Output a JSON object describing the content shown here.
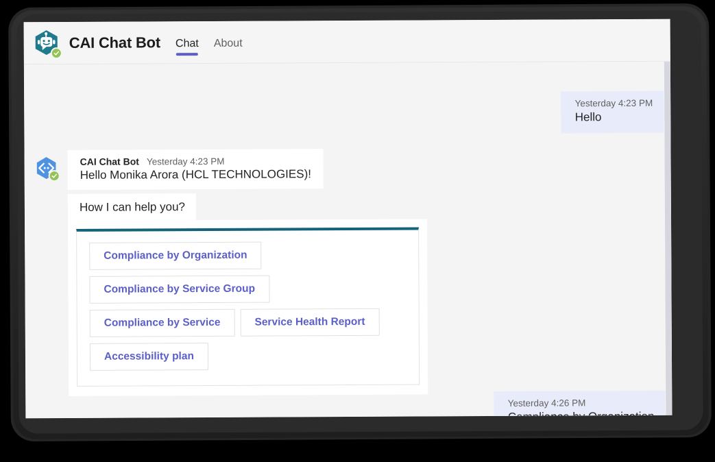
{
  "app": {
    "title": "CAI Chat Bot",
    "avatar_icon": "robot-hexagon-icon",
    "presence": "available-check-badge"
  },
  "tabs": [
    {
      "label": "Chat",
      "active": true
    },
    {
      "label": "About",
      "active": false
    }
  ],
  "conversation": [
    {
      "kind": "outgoing",
      "timestamp": "Yesterday 4:23 PM",
      "text": "Hello"
    },
    {
      "kind": "incoming",
      "sender": "CAI Chat Bot",
      "timestamp": "Yesterday 4:23 PM",
      "text": "Hello Monika Arora (HCL TECHNOLOGIES)!",
      "avatar_icon": "code-hexagon-icon"
    },
    {
      "kind": "incoming-plain",
      "text": "How I can help you?"
    },
    {
      "kind": "card",
      "accent_color": "#14637a",
      "button_rows": [
        [
          "Compliance by Organization"
        ],
        [
          "Compliance by Service Group"
        ],
        [
          "Compliance by Service",
          "Service Health Report"
        ],
        [
          "Accessibility plan"
        ]
      ]
    },
    {
      "kind": "outgoing",
      "timestamp": "Yesterday 4:26 PM",
      "text": "Compliance by Organization"
    }
  ],
  "colors": {
    "accent_purple": "#5b5fc7",
    "card_accent_teal": "#14637a",
    "outgoing_bubble": "#e8ebfa",
    "incoming_bubble": "#ffffff",
    "chat_background": "#f4f4f4",
    "presence_green": "#92c353",
    "bot_avatar_teal": "#1f7a8c",
    "msg_avatar_blue": "#4f93e0"
  }
}
